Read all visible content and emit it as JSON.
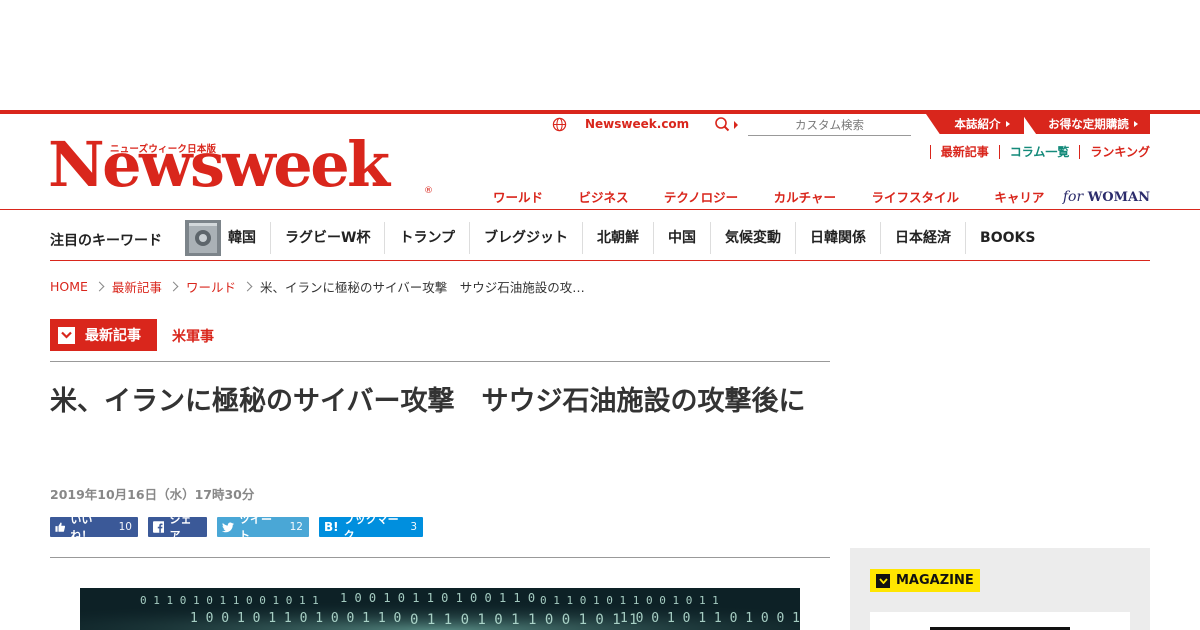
{
  "header": {
    "logo_sub": "ニューズウィーク日本版",
    "logo": "Newsweek",
    "site_link": "Newsweek.com",
    "search_placeholder": "カスタム検索",
    "tab_intro": "本誌紹介",
    "tab_subscription": "お得な定期購読",
    "util_links": [
      "最新記事",
      "コラム一覧",
      "ランキング"
    ],
    "categories": [
      "ワールド",
      "ビジネス",
      "テクノロジー",
      "カルチャー",
      "ライフスタイル",
      "キャリア"
    ],
    "woman_for": "for",
    "woman_text": "WOMAN"
  },
  "keywords": {
    "title": "注目のキーワード",
    "items": [
      "韓国",
      "ラグビーW杯",
      "トランプ",
      "ブレグジット",
      "北朝鮮",
      "中国",
      "気候変動",
      "日韓関係",
      "日本経済",
      "BOOKS"
    ]
  },
  "breadcrumb": {
    "home": "HOME",
    "latest": "最新記事",
    "world": "ワールド",
    "current": "米、イランに極秘のサイバー攻撃　サウジ石油施設の攻…"
  },
  "article": {
    "badge": "最新記事",
    "tag": "米軍事",
    "title": "米、イランに極秘のサイバー攻撃　サウジ石油施設の攻撃後に",
    "date": "2019年10月16日（水）17時30分"
  },
  "share": {
    "like_label": "いいね！",
    "like_count": "10",
    "fb_label": "シェア",
    "tweet_label": "ツイート",
    "tweet_count": "12",
    "hatena_label": "ブックマーク",
    "hatena_count": "3"
  },
  "sidebar": {
    "magazine_label": "MAGAZINE"
  },
  "colors": {
    "brand_red": "#d9261c",
    "teal": "#148a7a",
    "facebook": "#3b5998",
    "twitter": "#4aa7d6",
    "hatena": "#008fde",
    "magazine_yellow": "#ffe600"
  },
  "hero_image": {
    "binary_rows": [
      "0 1 1 0 1 0 1 1 0 0 1 0 1 1",
      "1 0 0 1 0 1 1 0 1 0 0 1 1 0"
    ]
  }
}
